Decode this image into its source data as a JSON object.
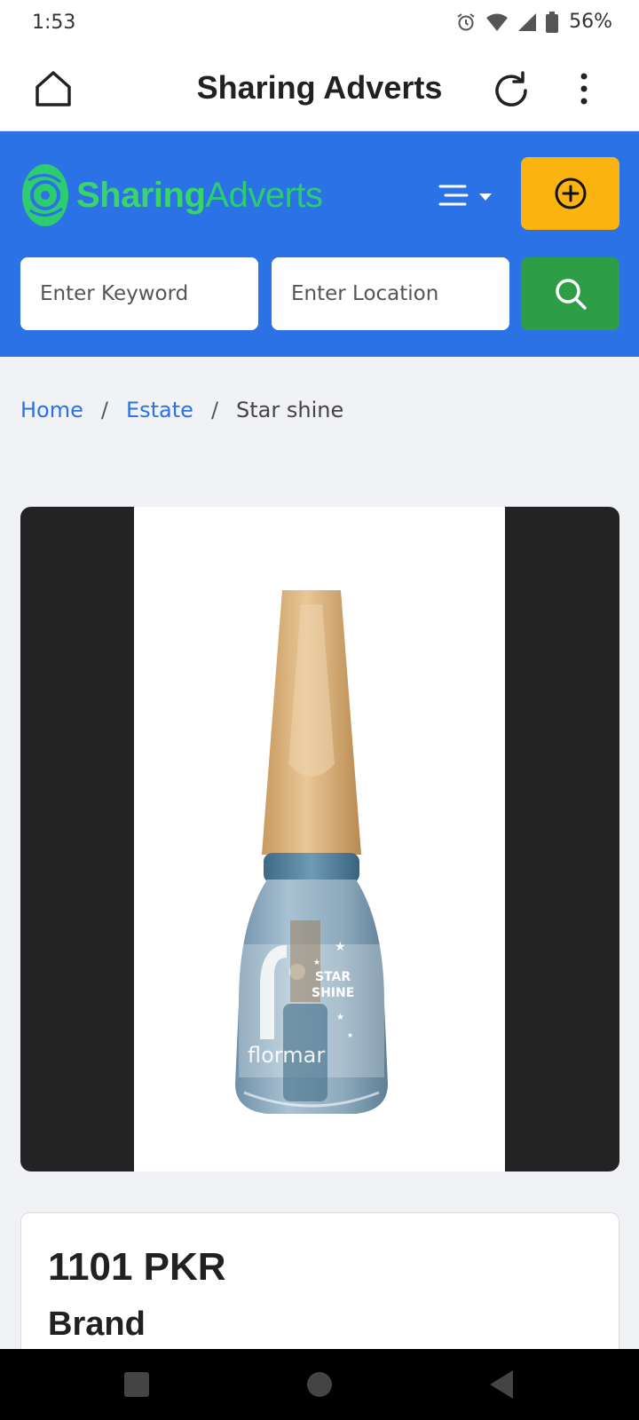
{
  "status_bar": {
    "time": "1:53",
    "battery": "56%",
    "icons": [
      "alarm-icon",
      "wifi-icon",
      "signal-icon",
      "battery-icon"
    ]
  },
  "app_bar": {
    "title": "Sharing Adverts",
    "icons": [
      "home-icon",
      "refresh-icon",
      "more-vert-icon"
    ]
  },
  "header": {
    "logo_text_bold": "Sharing",
    "logo_text_light": "Adverts",
    "menu_icon": "menu-lines-icon",
    "add_icon": "plus-circle-icon",
    "keyword_placeholder": "Enter Keyword",
    "location_placeholder": "Enter Location",
    "search_icon": "search-icon"
  },
  "breadcrumb": {
    "home": "Home",
    "category": "Estate",
    "current": "Star shine",
    "separator": "/"
  },
  "product": {
    "image_text": {
      "star_line1": "STAR",
      "star_line2": "SHINE",
      "brand_mark": "flormar"
    },
    "price": "1101 PKR",
    "brand_heading": "Brand"
  },
  "colors": {
    "header_blue": "#2a72e6",
    "add_yellow": "#fbb40f",
    "search_green": "#2e9e46",
    "logo_green": "#2ecc71",
    "link_blue": "#2a72e6"
  }
}
